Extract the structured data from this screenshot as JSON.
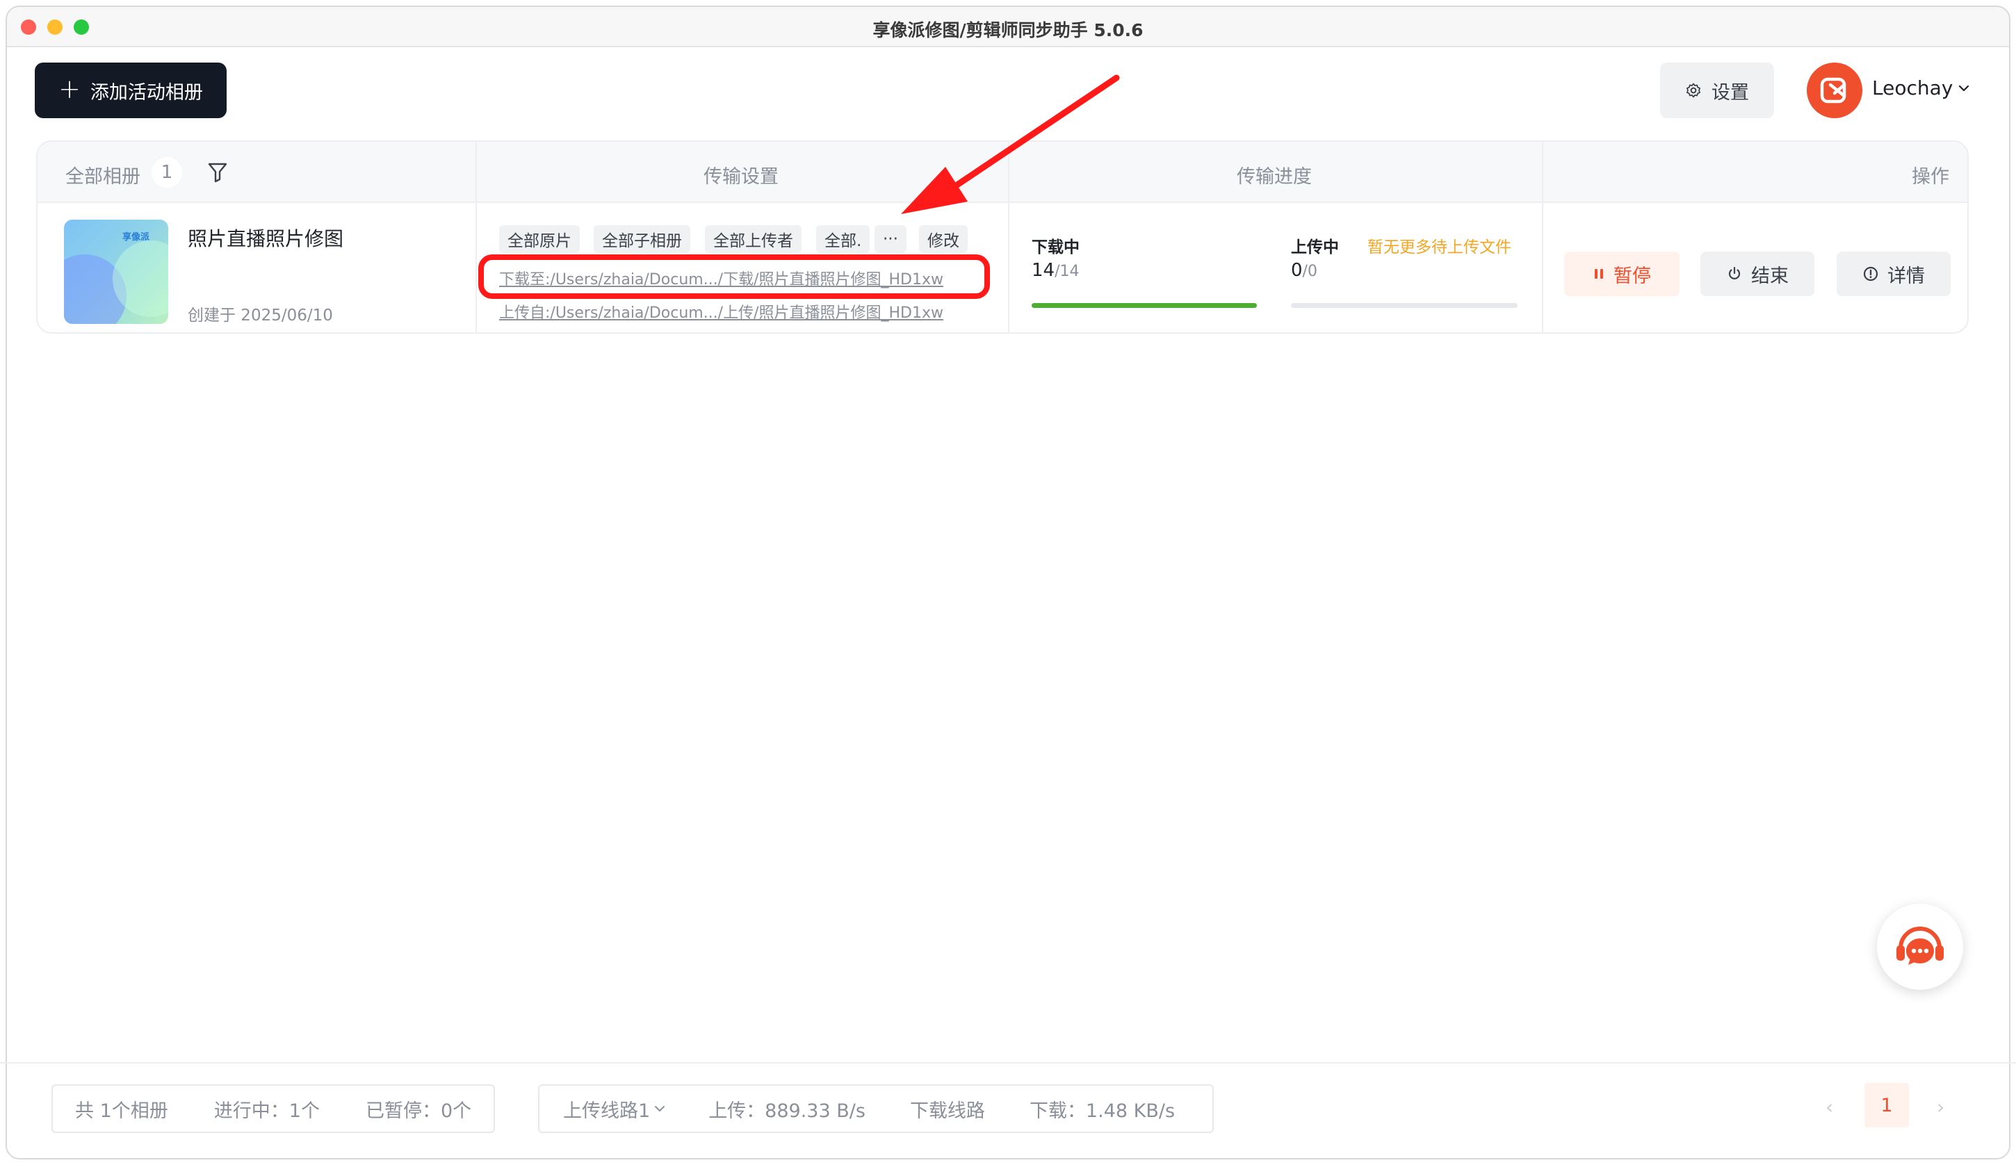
{
  "window": {
    "title": "享像派修图/剪辑师同步助手 5.0.6"
  },
  "toolbar": {
    "add_album_label": "添加活动相册",
    "settings_label": "设置"
  },
  "user": {
    "name": "Leochay"
  },
  "table": {
    "headers": {
      "albums": "全部相册",
      "album_count": "1",
      "transfer_settings": "传输设置",
      "transfer_progress": "传输进度",
      "actions": "操作"
    },
    "row": {
      "thumb_mark": "享像派",
      "name": "照片直播照片修图",
      "created": "创建于 2025/06/10",
      "tags": [
        "全部原片",
        "全部子相册",
        "全部上传者",
        "全部.",
        "···"
      ],
      "modify_label": "修改",
      "download_path": "下载至:/Users/zhaia/Docum.../下载/照片直播照片修图_HD1xw",
      "upload_path": "上传自:/Users/zhaia/Docum.../上传/照片直播照片修图_HD1xw",
      "download": {
        "label": "下载中",
        "done": "14",
        "total": "/14",
        "progress": 1.0
      },
      "upload": {
        "label": "上传中",
        "done": "0",
        "total": "/0",
        "progress": 0.0,
        "note": "暂无更多待上传文件"
      },
      "pause_label": "暂停",
      "end_label": "结束",
      "detail_label": "详情"
    }
  },
  "footer": {
    "total": "共 1个相册",
    "running": "进行中：1个",
    "paused": "已暂停：0个",
    "upload_route": "上传线路1",
    "upload_speed": "上传：889.33 B/s",
    "download_route": "下载线路",
    "download_speed": "下载：1.48 KB/s",
    "prev": "‹",
    "page": "1",
    "next": "›"
  },
  "colors": {
    "accent": "#f04f2e",
    "primary_dark": "#131a26",
    "progress_green": "#4caf32",
    "warning": "#f5a623",
    "annotation_red": "#ff1a1a"
  }
}
